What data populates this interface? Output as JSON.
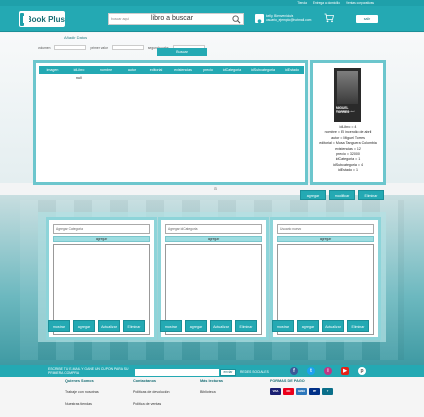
{
  "topbar": {
    "links": [
      "Tienda",
      "Entrega a domicilio",
      "Ventas corporativas"
    ]
  },
  "header": {
    "logo": "Book Plus",
    "search_placeholder": "buscar aqui",
    "search_value": "libro a buscar",
    "user_name": "kelly, Bienvenido/a",
    "user_email": "usuario_ejemplo@hotmail.com",
    "exit_label": "salir"
  },
  "page": {
    "title": "Añadir Datos",
    "deco_letter": "a"
  },
  "filters": {
    "fields": [
      "volumen",
      "primer valor",
      "segundo valor"
    ],
    "search_button": "Buscar"
  },
  "table": {
    "columns": [
      "imagen",
      "idLibro",
      "nombre",
      "autor",
      "editorial",
      "existencias",
      "precio",
      "idCategoria",
      "idSubcategoria",
      "idEstado"
    ],
    "first_cell": "null"
  },
  "detail": {
    "cover_title": "MIGUEL TORRES",
    "cover_subtitle": "El incendio de abril",
    "lines": [
      "idLibro = 4",
      "nombre = El incendio de abril",
      "autor = Miguel Torres",
      "editorial = Musa Tanguera Colombia",
      "existencias = 12",
      "precio = 32000",
      "idCategoria = 1",
      "idSubcategoria = 4",
      "idEstado = 1"
    ]
  },
  "actions": [
    "agregar",
    "modificar",
    "Eliminar"
  ],
  "panels": [
    {
      "placeholder": "Agregar Categoria",
      "add_label": "agregar",
      "buttons": [
        "mostrar",
        "agregar",
        "Actualizar",
        "Eliminar"
      ]
    },
    {
      "placeholder": "Agregar idCategoria",
      "add_label": "agregar",
      "buttons": [
        "mostrar",
        "agregar",
        "Actualizar",
        "Eliminar"
      ]
    },
    {
      "placeholder": "Usuario nuevo",
      "add_label": "agregar",
      "buttons": [
        "mostrar",
        "agregar",
        "Actualizar",
        "Eliminar"
      ]
    }
  ],
  "newsletter": {
    "text": "ESCRIBE TU E-MAIL Y GANE UN CUPON PARA SU PRIMERA COMPRA",
    "button": "enviar",
    "social_label": "REDES SOCIALES"
  },
  "footer": {
    "columns": [
      {
        "heading": "Quienes Somos",
        "items": [
          "Trabaje con nosotras",
          "Nuestras tiendas"
        ]
      },
      {
        "heading": "Contactanos",
        "items": [
          "Politicas de devolución",
          "Politica de ventas"
        ]
      },
      {
        "heading": "Más lecturas",
        "items": [
          "Biblioteca"
        ]
      }
    ],
    "payments_heading": "FORMAS DE PAGO",
    "payment_cards": [
      "VISA",
      "MC",
      "AMEX",
      "PP",
      "?"
    ]
  },
  "colors": {
    "accent": "#24a9b3",
    "accent_dark": "#1b8f98",
    "panel_border": "#8dd4d9"
  }
}
